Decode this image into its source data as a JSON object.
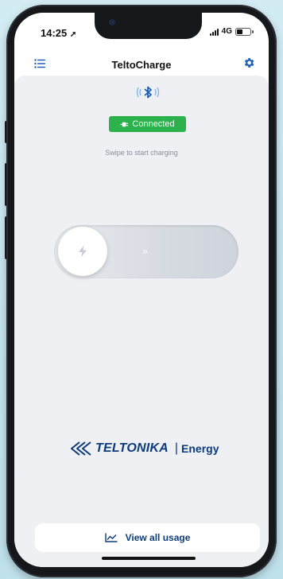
{
  "status_bar": {
    "time": "14:25",
    "network": "4G",
    "battery_level": 0.45
  },
  "header": {
    "title": "TeltoCharge",
    "menu_icon": "list-icon",
    "settings_icon": "gear-icon"
  },
  "connection": {
    "bluetooth_icon": "bluetooth-icon",
    "status_label": "Connected",
    "hint": "Swipe to start charging"
  },
  "slider": {
    "knob_icon": "lightning-icon",
    "arrows": "››"
  },
  "brand": {
    "name": "TELTONIKA",
    "separator": "|",
    "division": "Energy"
  },
  "footer": {
    "usage_label": "View all usage",
    "usage_icon": "line-chart-icon"
  },
  "colors": {
    "accent": "#0d3b7a",
    "icon_blue": "#1f5fb8",
    "connected_green": "#2bb24c",
    "surface": "#eef0f3"
  }
}
